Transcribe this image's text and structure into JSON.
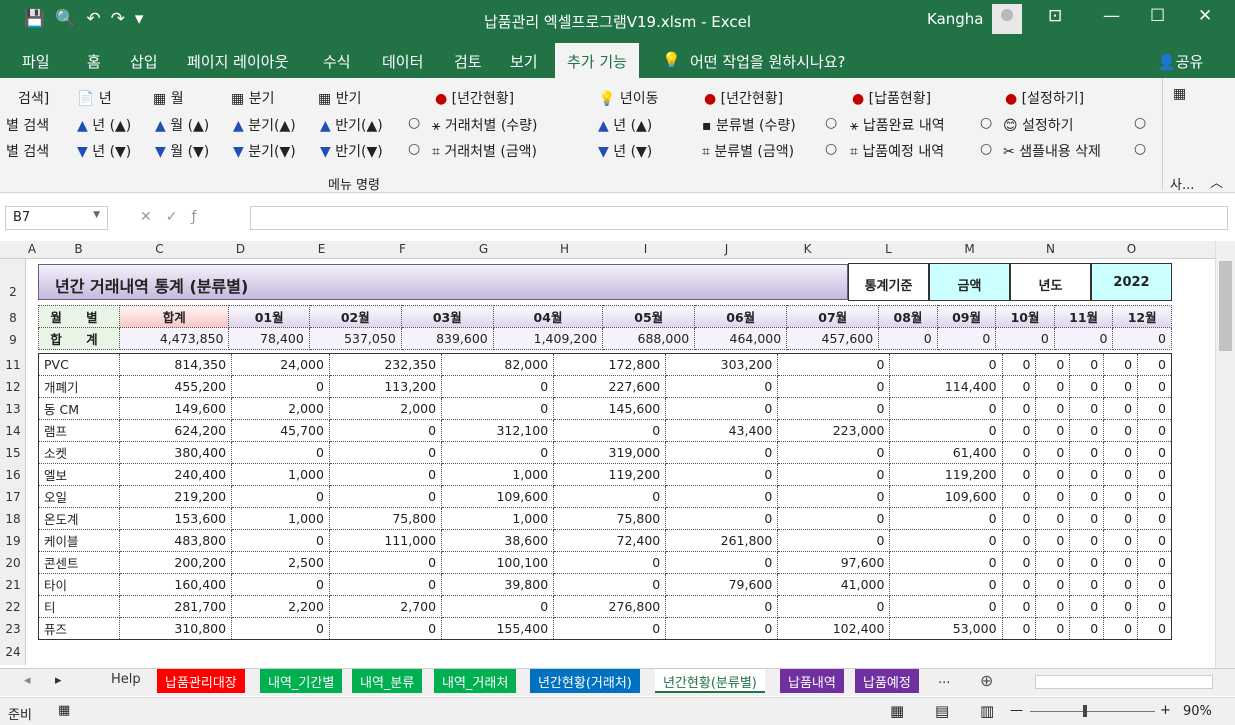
{
  "titlebar": {
    "title": "납품관리 엑셀프로그램V19.xlsm  -  Excel",
    "user": "Kangha"
  },
  "menu": [
    "파일",
    "홈",
    "삽입",
    "페이지 레이아웃",
    "수식",
    "데이터",
    "검토",
    "보기",
    "추가 기능",
    "어떤 작업을 원하시나요?",
    "공유"
  ],
  "ribbon": {
    "r1": [
      "검색]",
      "년",
      "월",
      "분기",
      "반기",
      "[년간현황]",
      "년이동",
      "[년간현황]",
      "[납품현황]",
      "[설정하기]"
    ],
    "r2": [
      "별 검색",
      "년 (▲)",
      "월 (▲)",
      "분기(▲)",
      "반기(▲)",
      "거래처별 (수량)",
      "년 (▲)",
      "분류별 (수량)",
      "납품완료 내역",
      "설정하기"
    ],
    "r3": [
      "별 검색",
      "년 (▼)",
      "월 (▼)",
      "분기(▼)",
      "반기(▼)",
      "거래처별 (금액)",
      "년 (▼)",
      "분류별 (금액)",
      "납품예정 내역",
      "샘플내용 삭제"
    ],
    "group_label": "메뉴 명령",
    "side_label": "사..."
  },
  "formula": {
    "name_box": "B7"
  },
  "columns": [
    "A",
    "B",
    "C",
    "D",
    "E",
    "F",
    "G",
    "H",
    "I",
    "J",
    "K",
    "L",
    "M",
    "N",
    "O"
  ],
  "rows": [
    "2",
    "8",
    "9",
    "11",
    "12",
    "13",
    "14",
    "15",
    "16",
    "17",
    "18",
    "19",
    "20",
    "21",
    "22",
    "23",
    "24"
  ],
  "sheet": {
    "title": "년간 거래내역 통계 (분류별)",
    "info": [
      "통계기준",
      "금액",
      "년도",
      "2022"
    ],
    "header": [
      "월 별",
      "합계",
      "01월",
      "02월",
      "03월",
      "04월",
      "05월",
      "06월",
      "07월",
      "08월",
      "09월",
      "10월",
      "11월",
      "12월"
    ],
    "total": [
      "합 계",
      "4,473,850",
      "78,400",
      "537,050",
      "839,600",
      "1,409,200",
      "688,000",
      "464,000",
      "457,600",
      "0",
      "0",
      "0",
      "0",
      "0"
    ],
    "data": [
      [
        "PVC",
        "814,350",
        "24,000",
        "232,350",
        "82,000",
        "172,800",
        "303,200",
        "0",
        "0",
        "0",
        "0",
        "0",
        "0",
        "0"
      ],
      [
        "개폐기",
        "455,200",
        "0",
        "113,200",
        "0",
        "227,600",
        "0",
        "0",
        "114,400",
        "0",
        "0",
        "0",
        "0",
        "0"
      ],
      [
        "동 CM",
        "149,600",
        "2,000",
        "2,000",
        "0",
        "145,600",
        "0",
        "0",
        "0",
        "0",
        "0",
        "0",
        "0",
        "0"
      ],
      [
        "램프",
        "624,200",
        "45,700",
        "0",
        "312,100",
        "0",
        "43,400",
        "223,000",
        "0",
        "0",
        "0",
        "0",
        "0",
        "0"
      ],
      [
        "소켓",
        "380,400",
        "0",
        "0",
        "0",
        "319,000",
        "0",
        "0",
        "61,400",
        "0",
        "0",
        "0",
        "0",
        "0"
      ],
      [
        "엘보",
        "240,400",
        "1,000",
        "0",
        "1,000",
        "119,200",
        "0",
        "0",
        "119,200",
        "0",
        "0",
        "0",
        "0",
        "0"
      ],
      [
        "오일",
        "219,200",
        "0",
        "0",
        "109,600",
        "0",
        "0",
        "0",
        "109,600",
        "0",
        "0",
        "0",
        "0",
        "0"
      ],
      [
        "온도계",
        "153,600",
        "1,000",
        "75,800",
        "1,000",
        "75,800",
        "0",
        "0",
        "0",
        "0",
        "0",
        "0",
        "0",
        "0"
      ],
      [
        "케이블",
        "483,800",
        "0",
        "111,000",
        "38,600",
        "72,400",
        "261,800",
        "0",
        "0",
        "0",
        "0",
        "0",
        "0",
        "0"
      ],
      [
        "콘센트",
        "200,200",
        "2,500",
        "0",
        "100,100",
        "0",
        "0",
        "97,600",
        "0",
        "0",
        "0",
        "0",
        "0",
        "0"
      ],
      [
        "타이",
        "160,400",
        "0",
        "0",
        "39,800",
        "0",
        "79,600",
        "41,000",
        "0",
        "0",
        "0",
        "0",
        "0",
        "0"
      ],
      [
        "티",
        "281,700",
        "2,200",
        "2,700",
        "0",
        "276,800",
        "0",
        "0",
        "0",
        "0",
        "0",
        "0",
        "0",
        "0"
      ],
      [
        "퓨즈",
        "310,800",
        "0",
        "0",
        "155,400",
        "0",
        "0",
        "102,400",
        "53,000",
        "0",
        "0",
        "0",
        "0",
        "0"
      ]
    ]
  },
  "tabs": [
    {
      "label": "Help",
      "color": "#f0f0f0",
      "text": "#333"
    },
    {
      "label": "납품관리대장",
      "color": "#ff0000",
      "text": "#fff"
    },
    {
      "label": "내역_기간별",
      "color": "#00b050",
      "text": "#fff"
    },
    {
      "label": "내역_분류",
      "color": "#00b050",
      "text": "#fff"
    },
    {
      "label": "내역_거래처",
      "color": "#00b050",
      "text": "#fff"
    },
    {
      "label": "년간현황(거래처)",
      "color": "#0070c0",
      "text": "#fff"
    },
    {
      "label": "년간현황(분류별)",
      "color": "#ffffff",
      "text": "#217346"
    },
    {
      "label": "납품내역",
      "color": "#7030a0",
      "text": "#fff"
    },
    {
      "label": "납품예정",
      "color": "#7030a0",
      "text": "#fff"
    },
    {
      "label": "...",
      "color": "#f0f0f0",
      "text": "#333"
    }
  ],
  "status": {
    "ready": "준비",
    "zoom": "90%"
  }
}
